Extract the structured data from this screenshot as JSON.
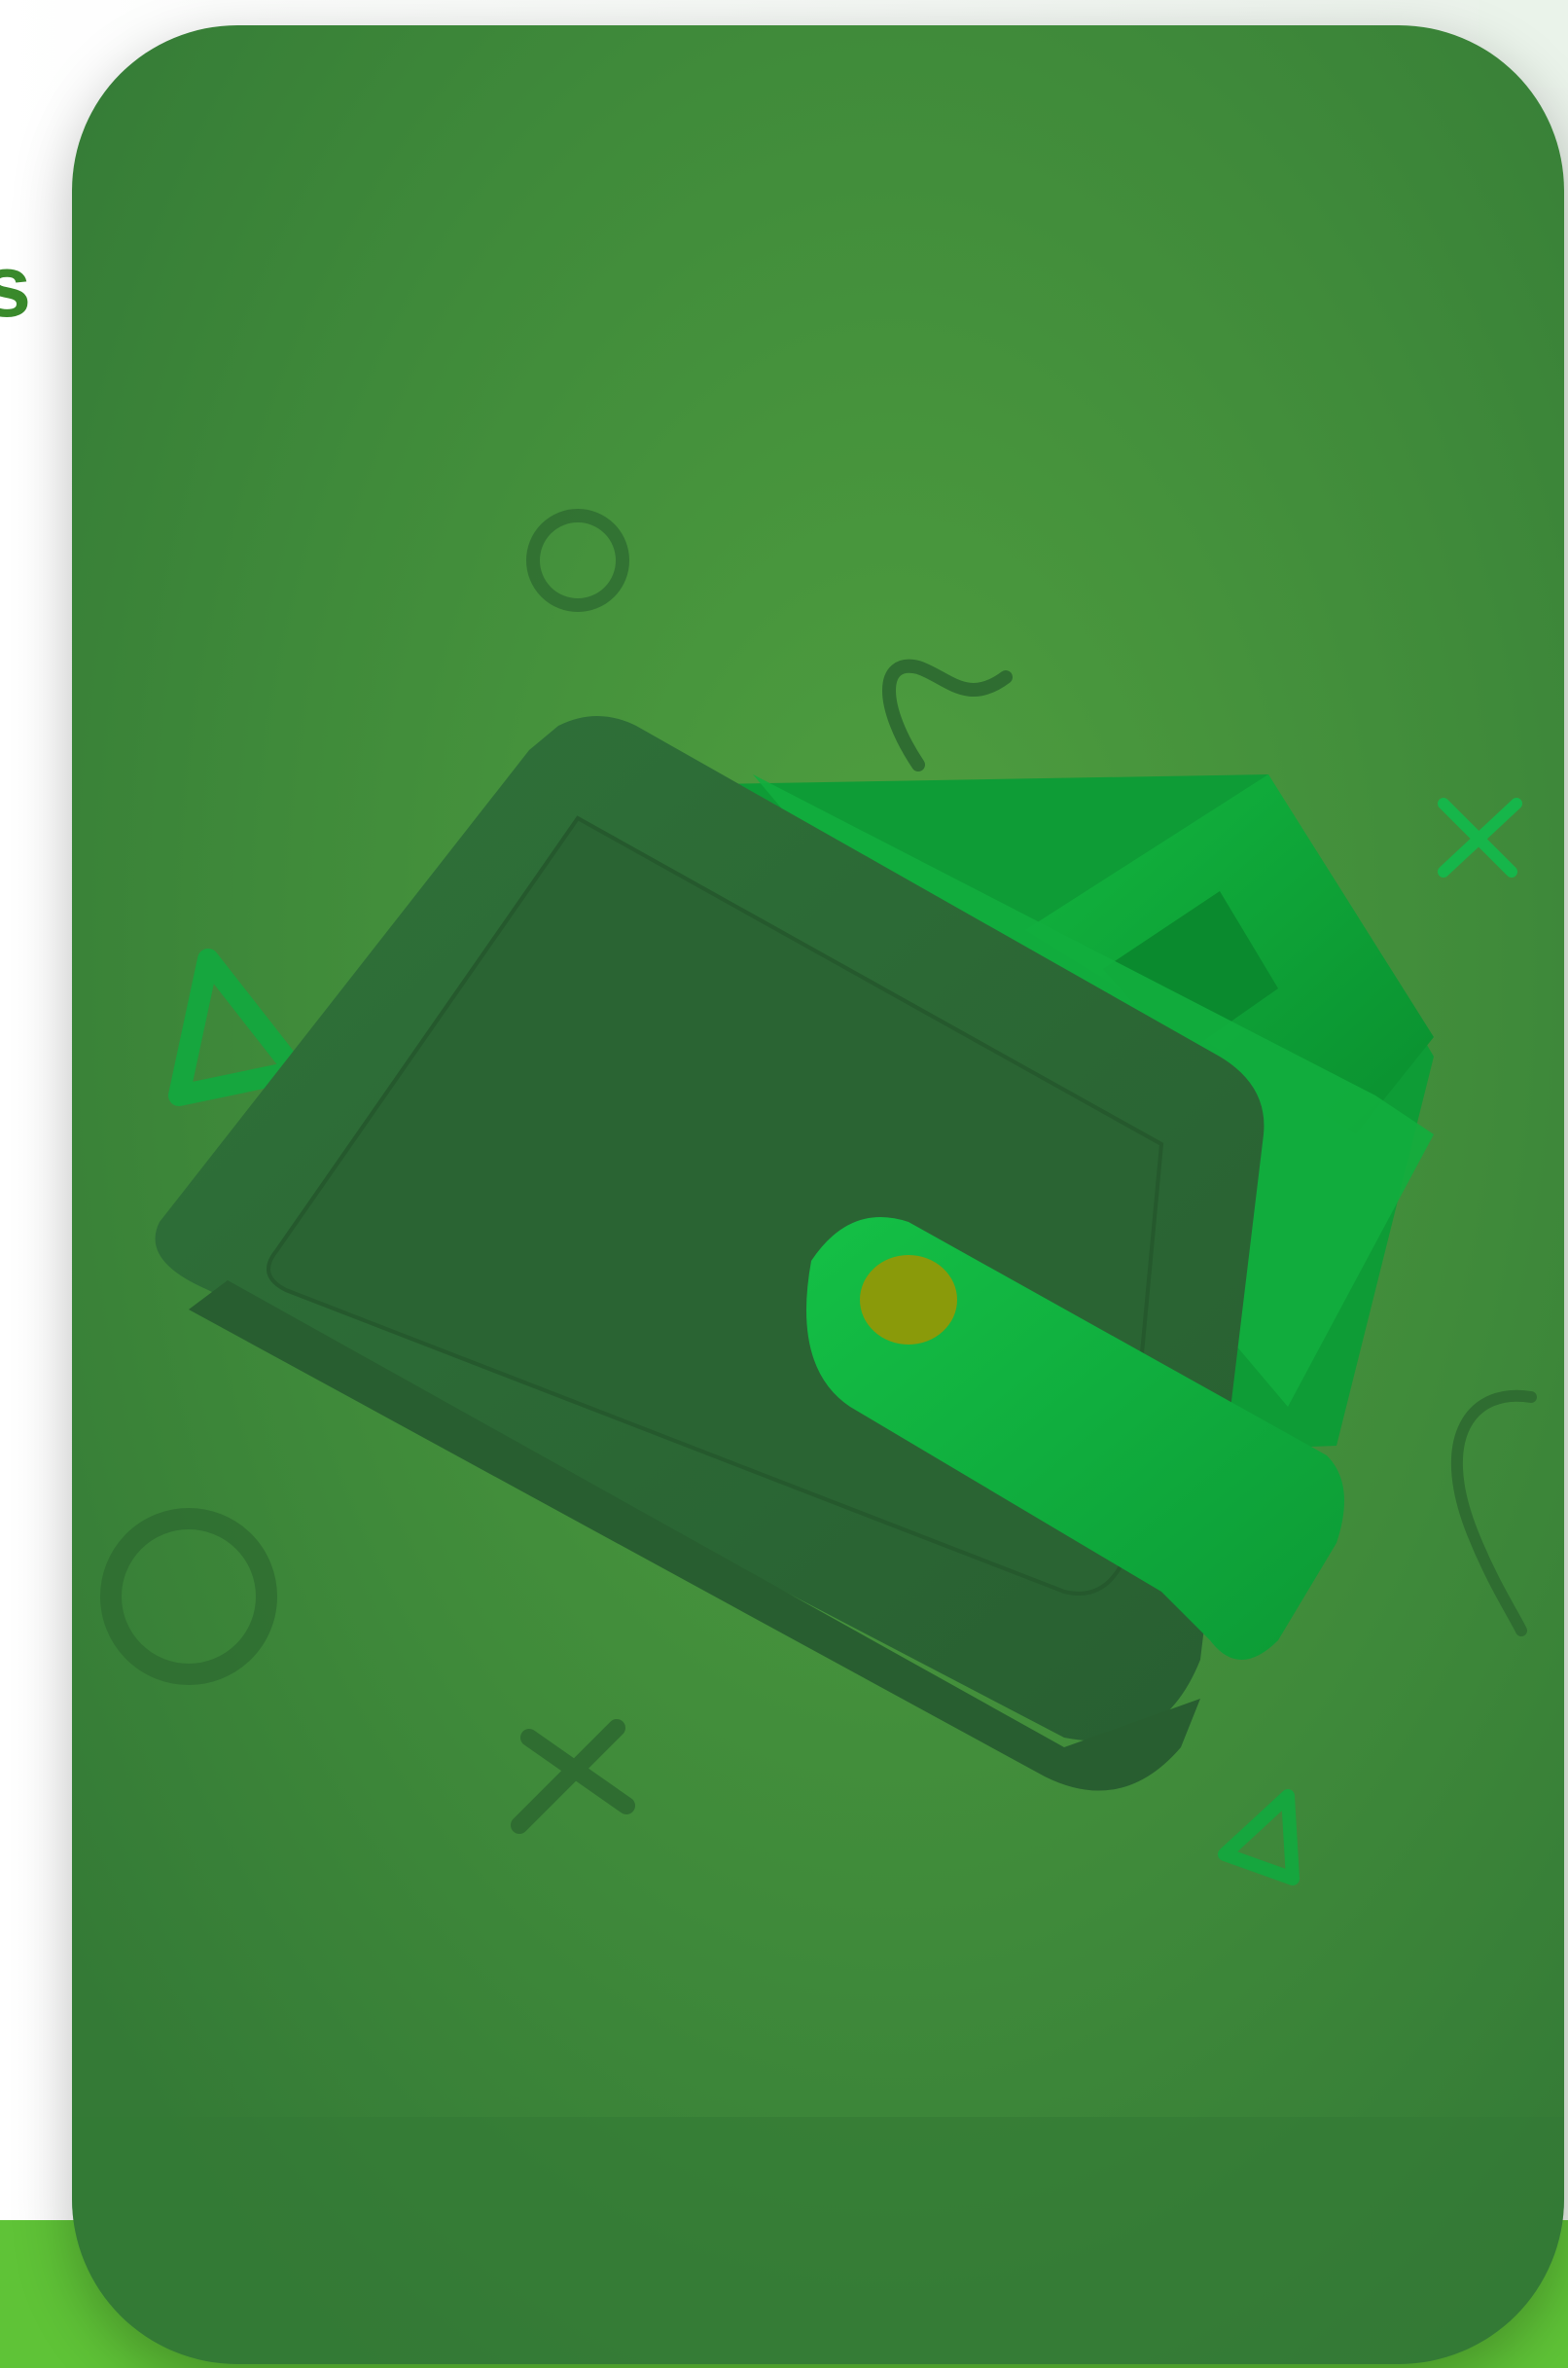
{
  "colors": {
    "card_base": "#3f8a3c",
    "card_glow": "#4e9f3f",
    "card_dark": "#2f6d31",
    "wallet_body": "#2d6b37",
    "wallet_inner": "#2a6433",
    "bill_green": "#0fa43a",
    "bill_dark": "#0a8a2e",
    "strap": "#10b03e",
    "button_gold": "#8a9a0a",
    "bottom_band": "#5fc337",
    "edge_glyph": "#3a8a2c"
  },
  "edge_glyph_text": "s",
  "decorations": {
    "ring_icon": "ring-icon",
    "squiggle_icon": "squiggle-icon",
    "cross_icon": "cross-icon",
    "triangle_icon": "triangle-icon"
  }
}
